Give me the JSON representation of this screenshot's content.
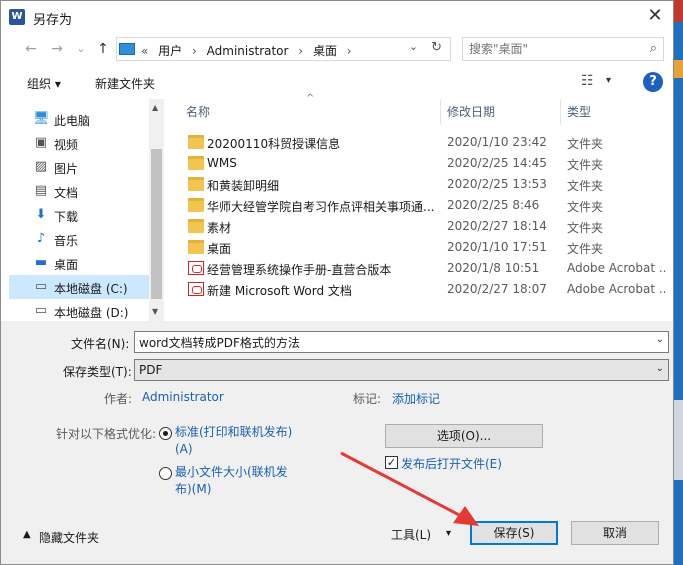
{
  "window": {
    "app_icon": "W",
    "title": "另存为",
    "close": "✕"
  },
  "nav": {
    "back": "←",
    "forward": "→",
    "recent": "⌄",
    "up": "↑"
  },
  "address": {
    "crumbs": [
      "«",
      "用户",
      "›",
      "Administrator",
      "›",
      "桌面",
      "›"
    ],
    "dropdown": "⌄",
    "refresh": "↻"
  },
  "search": {
    "placeholder": "搜索\"桌面\"",
    "icon": "⌕"
  },
  "toolbar": {
    "organize": "组织 ▾",
    "new_folder": "新建文件夹",
    "view_icon": "☷",
    "view_dd": "▾",
    "help": "?"
  },
  "sidebar": {
    "items": [
      {
        "icon": "🖥",
        "label": "此电脑"
      },
      {
        "icon": "▣",
        "label": "视频"
      },
      {
        "icon": "▨",
        "label": "图片"
      },
      {
        "icon": "▤",
        "label": "文档"
      },
      {
        "icon": "⬇",
        "label": "下载"
      },
      {
        "icon": "♪",
        "label": "音乐"
      },
      {
        "icon": "▬",
        "label": "桌面"
      },
      {
        "icon": "▭",
        "label": "本地磁盘 (C:)"
      },
      {
        "icon": "▭",
        "label": "本地磁盘 (D:)"
      }
    ],
    "scroll_up": "▲",
    "scroll_down": "▼"
  },
  "columns": {
    "name": "名称",
    "date": "修改日期",
    "type": "类型",
    "sort_caret": "^"
  },
  "files": [
    {
      "kind": "folder",
      "name": "20200110科贸授课信息",
      "date": "2020/1/10 23:42",
      "type": "文件夹"
    },
    {
      "kind": "folder",
      "name": "WMS",
      "date": "2020/2/25 14:45",
      "type": "文件夹"
    },
    {
      "kind": "folder",
      "name": "和黄装卸明细",
      "date": "2020/2/25 13:53",
      "type": "文件夹"
    },
    {
      "kind": "folder",
      "name": "华师大经管学院自考习作点评相关事项通...",
      "date": "2020/2/25 8:46",
      "type": "文件夹"
    },
    {
      "kind": "folder",
      "name": "素材",
      "date": "2020/2/27 18:14",
      "type": "文件夹"
    },
    {
      "kind": "folder",
      "name": "桌面",
      "date": "2020/1/10 17:51",
      "type": "文件夹"
    },
    {
      "kind": "pdf",
      "name": "经营管理系统操作手册-直营合版本",
      "date": "2020/1/8 10:51",
      "type": "Adobe Acrobat ..."
    },
    {
      "kind": "pdf",
      "name": "新建 Microsoft Word 文档",
      "date": "2020/2/27 18:07",
      "type": "Adobe Acrobat ..."
    }
  ],
  "form": {
    "filename_label": "文件名(N):",
    "filename_value": "word文档转成PDF格式的方法",
    "filetype_label": "保存类型(T):",
    "filetype_value": "PDF",
    "dropdown": "⌄",
    "author_label": "作者:",
    "author_value": "Administrator",
    "tags_label": "标记:",
    "tags_value": "添加标记",
    "optimize_label": "针对以下格式优化:",
    "opt1_line1": "标准(打印和联机发布)",
    "opt1_line2": "(A)",
    "opt2_line1": "最小文件大小(联机发",
    "opt2_line2": "布)(M)",
    "options_button": "选项(O)...",
    "open_after_label": "发布后打开文件(E)",
    "check": "✓"
  },
  "footer": {
    "hide_folders": "隐藏文件夹",
    "hide_caret": "▲",
    "tools": "工具(L)",
    "tools_dd": "▾",
    "save": "保存(S)",
    "cancel": "取消"
  },
  "colors": {
    "accent": "#0078d7",
    "link": "#1a5fb4",
    "folder": "#f1c550",
    "arrow": "#e53935"
  }
}
